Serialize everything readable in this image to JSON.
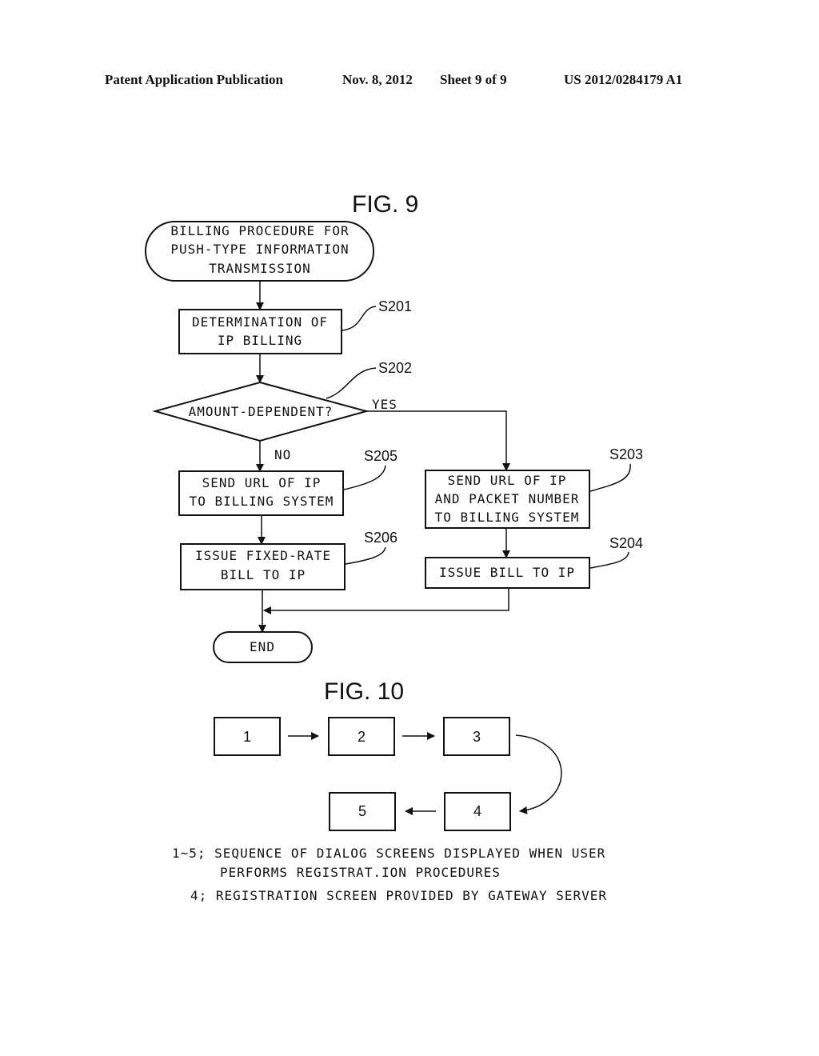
{
  "header": {
    "publication": "Patent Application Publication",
    "date": "Nov. 8, 2012",
    "sheet": "Sheet 9 of 9",
    "number": "US 2012/0284179 A1"
  },
  "fig9": {
    "title": "FIG. 9",
    "start": [
      "BILLING PROCEDURE FOR",
      "PUSH-TYPE INFORMATION",
      "TRANSMISSION"
    ],
    "s201": {
      "label": "S201",
      "lines": [
        "DETERMINATION OF",
        "IP BILLING"
      ]
    },
    "s202": {
      "label": "S202",
      "lines": [
        "AMOUNT-DEPENDENT?"
      ],
      "yes": "YES",
      "no": "NO"
    },
    "s203": {
      "label": "S203",
      "lines": [
        "SEND URL OF IP",
        "AND PACKET NUMBER",
        "TO BILLING SYSTEM"
      ]
    },
    "s204": {
      "label": "S204",
      "lines": [
        "ISSUE BILL TO IP"
      ]
    },
    "s205": {
      "label": "S205",
      "lines": [
        "SEND URL OF IP",
        "TO BILLING SYSTEM"
      ]
    },
    "s206": {
      "label": "S206",
      "lines": [
        "ISSUE FIXED-RATE",
        "BILL TO IP"
      ]
    },
    "end": "END"
  },
  "fig10": {
    "title": "FIG. 10",
    "screens": [
      "1",
      "2",
      "3",
      "4",
      "5"
    ],
    "legend": [
      "1~5; SEQUENCE OF DIALOG SCREENS DISPLAYED WHEN USER",
      "PERFORMS REGISTRAT.ION PROCEDURES",
      "4; REGISTRATION SCREEN PROVIDED BY GATEWAY SERVER"
    ]
  }
}
